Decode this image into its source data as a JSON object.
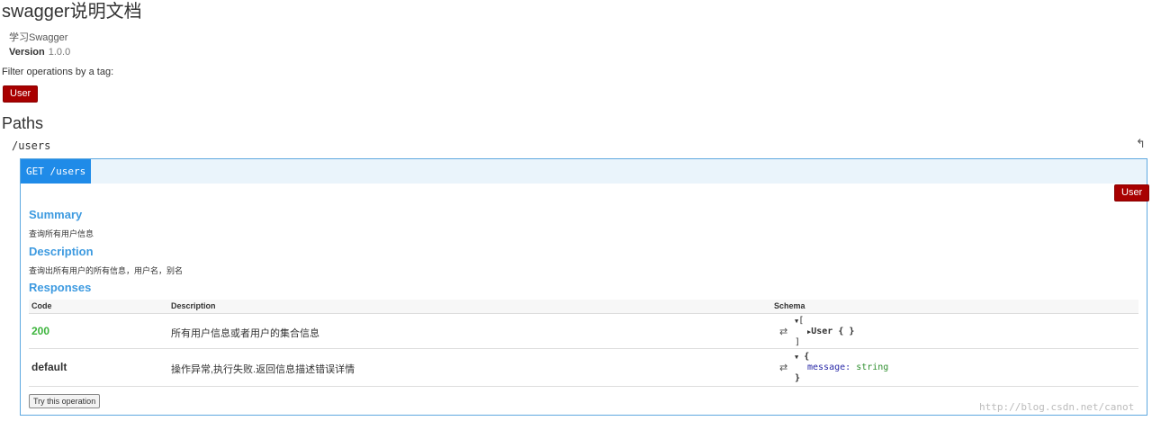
{
  "header": {
    "title": "swagger说明文档",
    "description": "学习Swagger",
    "version_label": "Version",
    "version_value": "1.0.0",
    "filter_label": "Filter operations by a tag:",
    "tag": "User"
  },
  "paths": {
    "heading": "Paths",
    "path": "/users",
    "back_icon": "reply-icon",
    "operation": {
      "method_path": "GET /users",
      "tag": "User",
      "summary_heading": "Summary",
      "summary_text": "查询所有用户信息",
      "description_heading": "Description",
      "description_text": "查询出所有用户的所有信息，用户名，别名",
      "responses_heading": "Responses",
      "columns": [
        "Code",
        "Description",
        "Schema"
      ],
      "responses": [
        {
          "code": "200",
          "description": "所有用户信息或者用户的集合信息",
          "schema_open": "[",
          "schema_item": "User { }",
          "schema_close": "]"
        },
        {
          "code": "default",
          "description": "操作异常,执行失败.返回信息描述错误详情",
          "schema_open": "{",
          "schema_key": "message:",
          "schema_type": "string",
          "schema_close": "}"
        }
      ],
      "try_button": "Try this operation"
    }
  },
  "watermark": "http://blog.csdn.net/canot",
  "colors": {
    "tag_bg": "#a80000",
    "method_bg": "#1f8be8",
    "section_heading": "#3d9ae0",
    "code_200": "#3cb43c"
  }
}
